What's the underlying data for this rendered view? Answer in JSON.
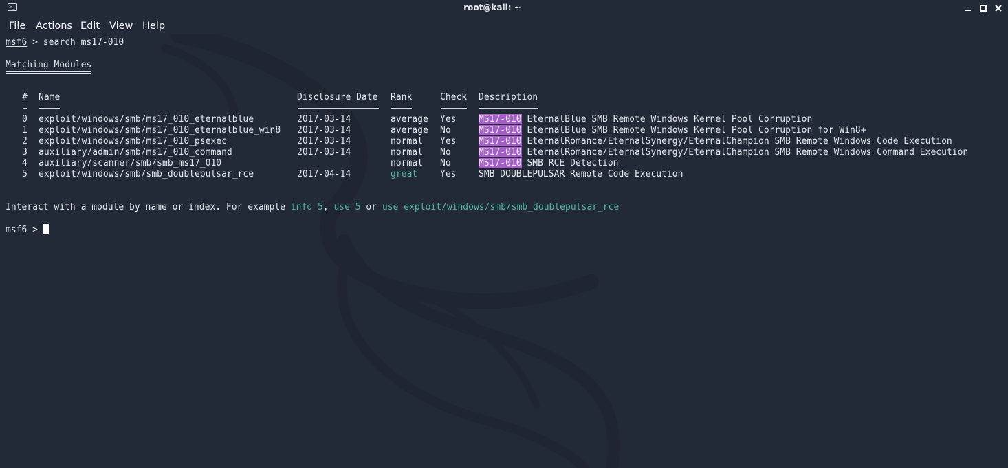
{
  "window": {
    "title": "root@kali: ~",
    "icon": "terminal-icon",
    "controls": [
      "minimize-icon",
      "maximize-icon",
      "close-icon"
    ]
  },
  "menu": [
    "File",
    "Actions",
    "Edit",
    "View",
    "Help"
  ],
  "terminal": {
    "prompt": "msf6",
    "prompt_sep": " > ",
    "command": "search ms17-010",
    "section_title": "Matching Modules",
    "headers": {
      "num": "#",
      "name": "Name",
      "date": "Disclosure Date",
      "rank": "Rank",
      "check": "Check",
      "desc": "Description"
    },
    "rows": [
      {
        "num": "0",
        "name": "exploit/windows/smb/ms17_010_eternalblue",
        "date": "2017-03-14",
        "rank": "average",
        "check": "Yes",
        "match": "MS17-010",
        "desc": " EternalBlue SMB Remote Windows Kernel Pool Corruption"
      },
      {
        "num": "1",
        "name": "exploit/windows/smb/ms17_010_eternalblue_win8",
        "date": "2017-03-14",
        "rank": "average",
        "check": "No",
        "match": "MS17-010",
        "desc": " EternalBlue SMB Remote Windows Kernel Pool Corruption for Win8+"
      },
      {
        "num": "2",
        "name": "exploit/windows/smb/ms17_010_psexec",
        "date": "2017-03-14",
        "rank": "normal",
        "check": "Yes",
        "match": "MS17-010",
        "desc": " EternalRomance/EternalSynergy/EternalChampion SMB Remote Windows Code Execution"
      },
      {
        "num": "3",
        "name": "auxiliary/admin/smb/ms17_010_command",
        "date": "2017-03-14",
        "rank": "normal",
        "check": "No",
        "match": "MS17-010",
        "desc": " EternalRomance/EternalSynergy/EternalChampion SMB Remote Windows Command Execution"
      },
      {
        "num": "4",
        "name": "auxiliary/scanner/smb/smb_ms17_010",
        "date": "",
        "rank": "normal",
        "check": "No",
        "match": "MS17-010",
        "desc": " SMB RCE Detection"
      },
      {
        "num": "5",
        "name": "exploit/windows/smb/smb_doublepulsar_rce",
        "date": "2017-04-14",
        "rank": "great",
        "check": "Yes",
        "match": "",
        "desc": "SMB DOUBLEPULSAR Remote Code Execution"
      }
    ],
    "hint": {
      "prefix": "Interact with a module by name or index. For example ",
      "ex1": "info 5",
      "sep1": ", ",
      "ex2": "use 5",
      "sep2": " or ",
      "ex3": "use exploit/windows/smb/smb_doublepulsar_rce"
    }
  },
  "colors": {
    "background": "#232a37",
    "highlight": "#a560c8",
    "green": "#4fb5a1",
    "text": "#e2e5ea"
  }
}
